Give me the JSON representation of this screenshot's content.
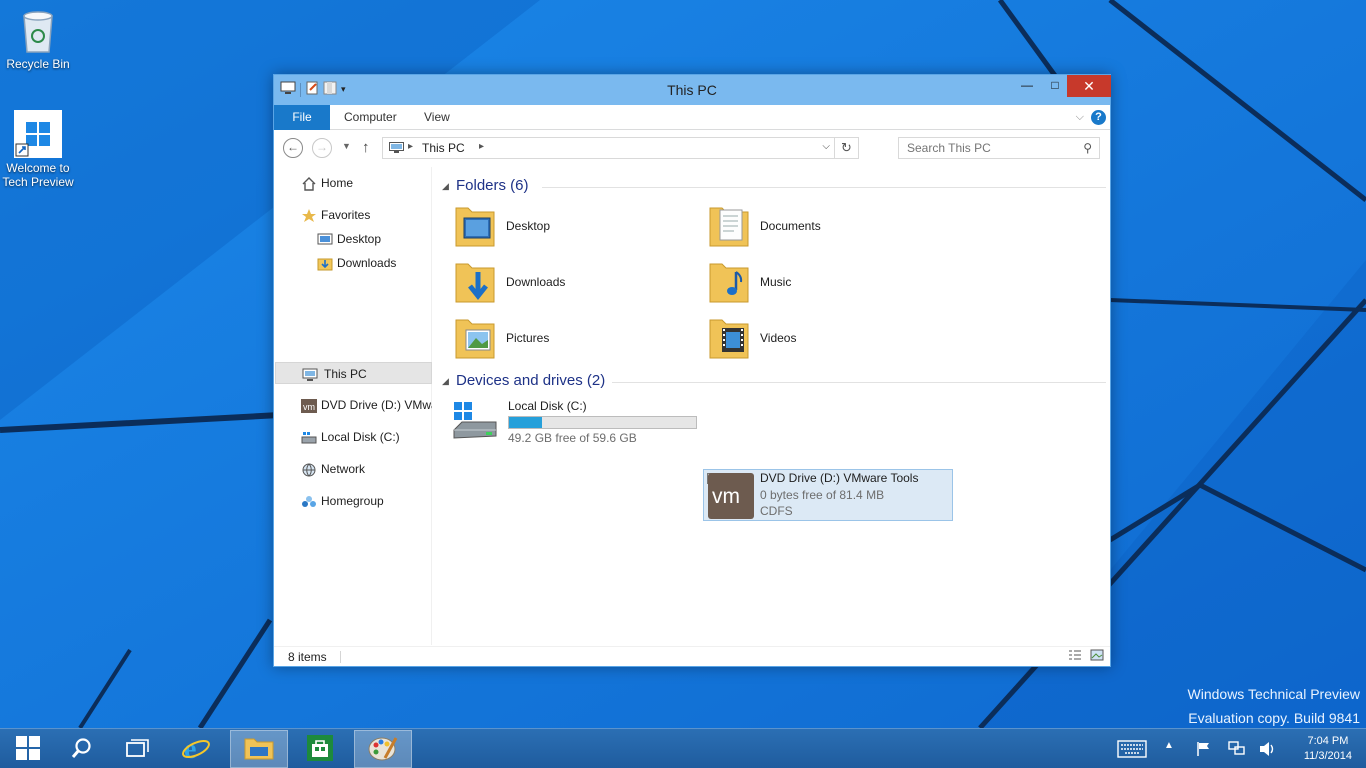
{
  "desktop": {
    "icons": [
      {
        "label": "Recycle Bin"
      },
      {
        "label_line1": "Welcome to",
        "label_line2": "Tech Preview"
      }
    ],
    "watermark_line1": "Windows Technical Preview",
    "watermark_line2": "Evaluation copy. Build 9841"
  },
  "window": {
    "title": "This PC",
    "buttons": {
      "minimize": "—",
      "maximize": "□",
      "close": "✕"
    },
    "ribbon_tabs": [
      {
        "label": "File",
        "active": true
      },
      {
        "label": "Computer"
      },
      {
        "label": "View"
      }
    ],
    "address": {
      "crumb": "This PC"
    },
    "search": {
      "placeholder": "Search This PC"
    },
    "nav_pane": [
      {
        "label": "Home",
        "icon": "home-icon"
      },
      {
        "label": "Favorites",
        "icon": "star-icon"
      },
      {
        "label": "Desktop",
        "icon": "desktop-icon"
      },
      {
        "label": "Downloads",
        "icon": "downloads-icon"
      },
      {
        "label": "This PC",
        "icon": "computer-icon",
        "selected": true
      },
      {
        "label": "DVD Drive (D:) VMware Tools",
        "icon": "vmware-icon"
      },
      {
        "label": "Local Disk (C:)",
        "icon": "disk-icon"
      },
      {
        "label": "Network",
        "icon": "network-icon"
      },
      {
        "label": "Homegroup",
        "icon": "homegroup-icon"
      }
    ],
    "groups": {
      "folders": {
        "title": "Folders (6)"
      },
      "drives": {
        "title": "Devices and drives (2)"
      }
    },
    "folders": [
      {
        "label": "Desktop"
      },
      {
        "label": "Documents"
      },
      {
        "label": "Downloads"
      },
      {
        "label": "Music"
      },
      {
        "label": "Pictures"
      },
      {
        "label": "Videos"
      }
    ],
    "drives": [
      {
        "name": "Local Disk (C:)",
        "free": "49.2 GB free of 59.6 GB",
        "used_fraction": 0.175
      },
      {
        "name": "DVD Drive (D:) VMware Tools",
        "free": "0 bytes free of 81.4 MB",
        "fs": "CDFS",
        "selected": true
      }
    ],
    "status": {
      "items": "8 items"
    }
  },
  "taskbar": {
    "apps": [
      {
        "icon": "start-icon"
      },
      {
        "icon": "search-icon"
      },
      {
        "icon": "task-view-icon"
      },
      {
        "icon": "internet-explorer-icon"
      },
      {
        "icon": "file-explorer-icon",
        "active": true
      },
      {
        "icon": "store-icon"
      },
      {
        "icon": "paint-icon",
        "active": true
      }
    ],
    "clock": {
      "time": "7:04 PM",
      "date": "11/3/2014"
    }
  },
  "colors": {
    "accent": "#1979ca",
    "close": "#c7392b",
    "titlebar": "#7ab9ef",
    "group_header": "#1e3287"
  }
}
